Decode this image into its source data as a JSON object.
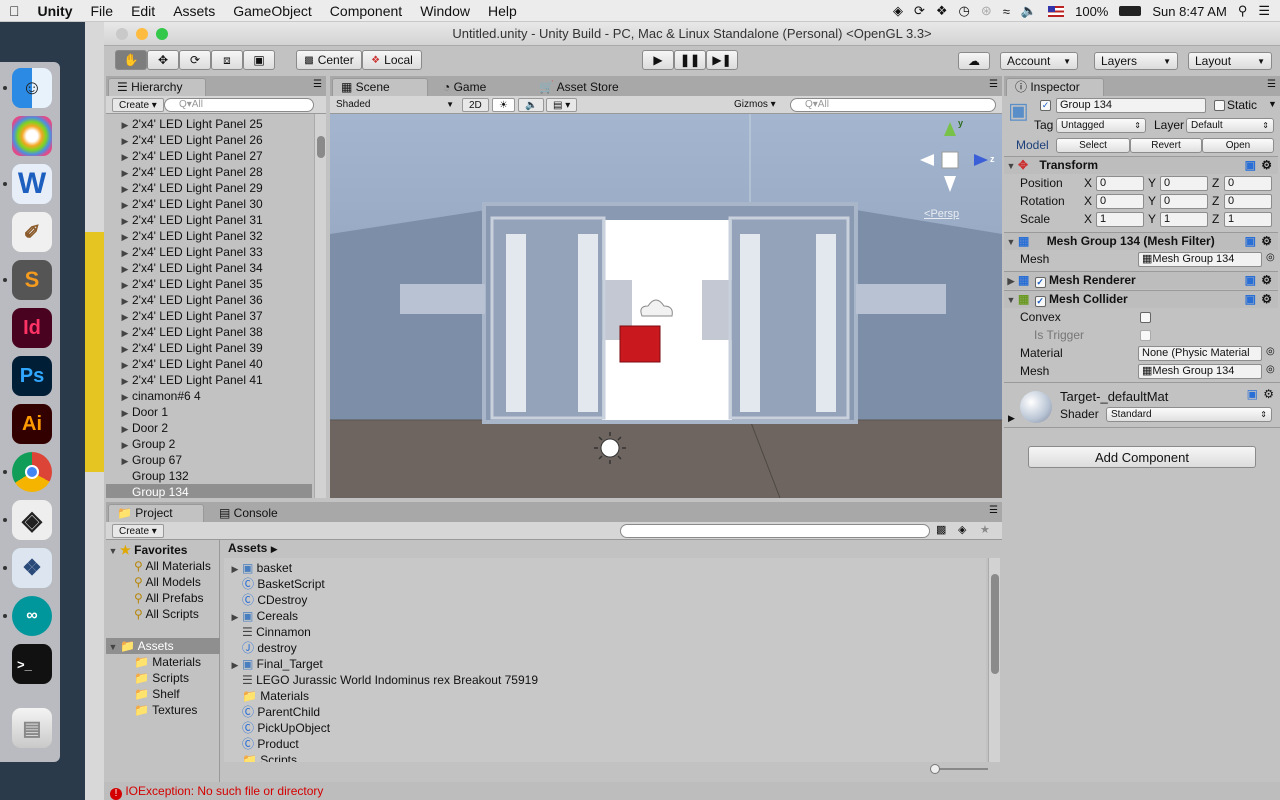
{
  "menubar": {
    "app": "Unity",
    "items": [
      "File",
      "Edit",
      "Assets",
      "GameObject",
      "Component",
      "Window",
      "Help"
    ],
    "battery": "100%",
    "clock": "Sun 8:47 AM"
  },
  "window": {
    "title": "Untitled.unity - Unity Build - PC, Mac & Linux Standalone (Personal) <OpenGL 3.3>"
  },
  "toolbar": {
    "pivot": "Center",
    "space": "Local",
    "account": "Account",
    "layers": "Layers",
    "layout": "Layout"
  },
  "hierarchy": {
    "tab": "Hierarchy",
    "create": "Create",
    "search_placeholder": "Q▾All",
    "items": [
      {
        "label": "2'x4' LED Light Panel 25",
        "arrow": true
      },
      {
        "label": "2'x4' LED Light Panel 26",
        "arrow": true
      },
      {
        "label": "2'x4' LED Light Panel 27",
        "arrow": true
      },
      {
        "label": "2'x4' LED Light Panel 28",
        "arrow": true
      },
      {
        "label": "2'x4' LED Light Panel 29",
        "arrow": true
      },
      {
        "label": "2'x4' LED Light Panel 30",
        "arrow": true
      },
      {
        "label": "2'x4' LED Light Panel 31",
        "arrow": true
      },
      {
        "label": "2'x4' LED Light Panel 32",
        "arrow": true
      },
      {
        "label": "2'x4' LED Light Panel 33",
        "arrow": true
      },
      {
        "label": "2'x4' LED Light Panel 34",
        "arrow": true
      },
      {
        "label": "2'x4' LED Light Panel 35",
        "arrow": true
      },
      {
        "label": "2'x4' LED Light Panel 36",
        "arrow": true
      },
      {
        "label": "2'x4' LED Light Panel 37",
        "arrow": true
      },
      {
        "label": "2'x4' LED Light Panel 38",
        "arrow": true
      },
      {
        "label": "2'x4' LED Light Panel 39",
        "arrow": true
      },
      {
        "label": "2'x4' LED Light Panel 40",
        "arrow": true
      },
      {
        "label": "2'x4' LED Light Panel 41",
        "arrow": true
      },
      {
        "label": "cinamon#6 4",
        "arrow": true
      },
      {
        "label": "Door 1",
        "arrow": true
      },
      {
        "label": "Door 2",
        "arrow": true
      },
      {
        "label": "Group 2",
        "arrow": true
      },
      {
        "label": "Group 67",
        "arrow": true
      },
      {
        "label": "Group 132",
        "arrow": false
      },
      {
        "label": "Group 134",
        "arrow": false,
        "selected": true
      }
    ]
  },
  "scene": {
    "tabs": [
      "Scene",
      "Game",
      "Asset Store"
    ],
    "shading": "Shaded",
    "mode2d": "2D",
    "gizmos": "Gizmos",
    "search_placeholder": "Q▾All",
    "persp": "Persp"
  },
  "project": {
    "tabs": [
      "Project",
      "Console"
    ],
    "create": "Create",
    "favorites_label": "Favorites",
    "favorites": [
      "All Materials",
      "All Models",
      "All Prefabs",
      "All Scripts"
    ],
    "assets_label": "Assets",
    "folders": [
      "Materials",
      "Scripts",
      "Shelf",
      "Textures"
    ],
    "breadcrumb": "Assets",
    "assets": [
      {
        "label": "basket",
        "type": "prefab",
        "arrow": true
      },
      {
        "label": "BasketScript",
        "type": "cs"
      },
      {
        "label": "CDestroy",
        "type": "cs"
      },
      {
        "label": "Cereals",
        "type": "prefab",
        "arrow": true
      },
      {
        "label": "Cinnamon",
        "type": "doc"
      },
      {
        "label": "destroy",
        "type": "js"
      },
      {
        "label": "Final_Target",
        "type": "prefab",
        "arrow": true
      },
      {
        "label": "LEGO Jurassic World Indominus rex Breakout 75919",
        "type": "doc"
      },
      {
        "label": "Materials",
        "type": "folder"
      },
      {
        "label": "ParentChild",
        "type": "cs"
      },
      {
        "label": "PickUpObject",
        "type": "cs"
      },
      {
        "label": "Product",
        "type": "cs"
      },
      {
        "label": "Scripts",
        "type": "folder"
      }
    ]
  },
  "status": {
    "message": "IOException: No such file or directory",
    "color": "#d40000"
  },
  "inspector": {
    "tab": "Inspector",
    "object_name": "Group 134",
    "static_label": "Static",
    "tag_label": "Tag",
    "tag_value": "Untagged",
    "layer_label": "Layer",
    "layer_value": "Default",
    "model_label": "Model",
    "model_buttons": [
      "Select",
      "Revert",
      "Open"
    ],
    "transform": {
      "title": "Transform",
      "rows": [
        {
          "label": "Position",
          "x": "0",
          "y": "0",
          "z": "0"
        },
        {
          "label": "Rotation",
          "x": "0",
          "y": "0",
          "z": "0"
        },
        {
          "label": "Scale",
          "x": "1",
          "y": "1",
          "z": "1"
        }
      ]
    },
    "axis": [
      "X",
      "Y",
      "Z"
    ],
    "mesh_filter": {
      "title": "Mesh Group 134 (Mesh Filter)",
      "label": "Mesh",
      "value": "Mesh Group 134"
    },
    "mesh_renderer": {
      "title": "Mesh Renderer"
    },
    "mesh_collider": {
      "title": "Mesh Collider",
      "convex": "Convex",
      "is_trigger": "Is Trigger",
      "material_label": "Material",
      "material_value": "None (Physic Material",
      "mesh_label": "Mesh",
      "mesh_value": "Mesh Group 134"
    },
    "material": {
      "name": "Target-_defaultMat",
      "shader_label": "Shader",
      "shader_value": "Standard"
    },
    "add_component": "Add Component"
  },
  "colors": {
    "accent": "#2a6fd6",
    "selected": "#8f8f8f",
    "sky": "#a4b6cf",
    "floor": "#6e6560"
  }
}
